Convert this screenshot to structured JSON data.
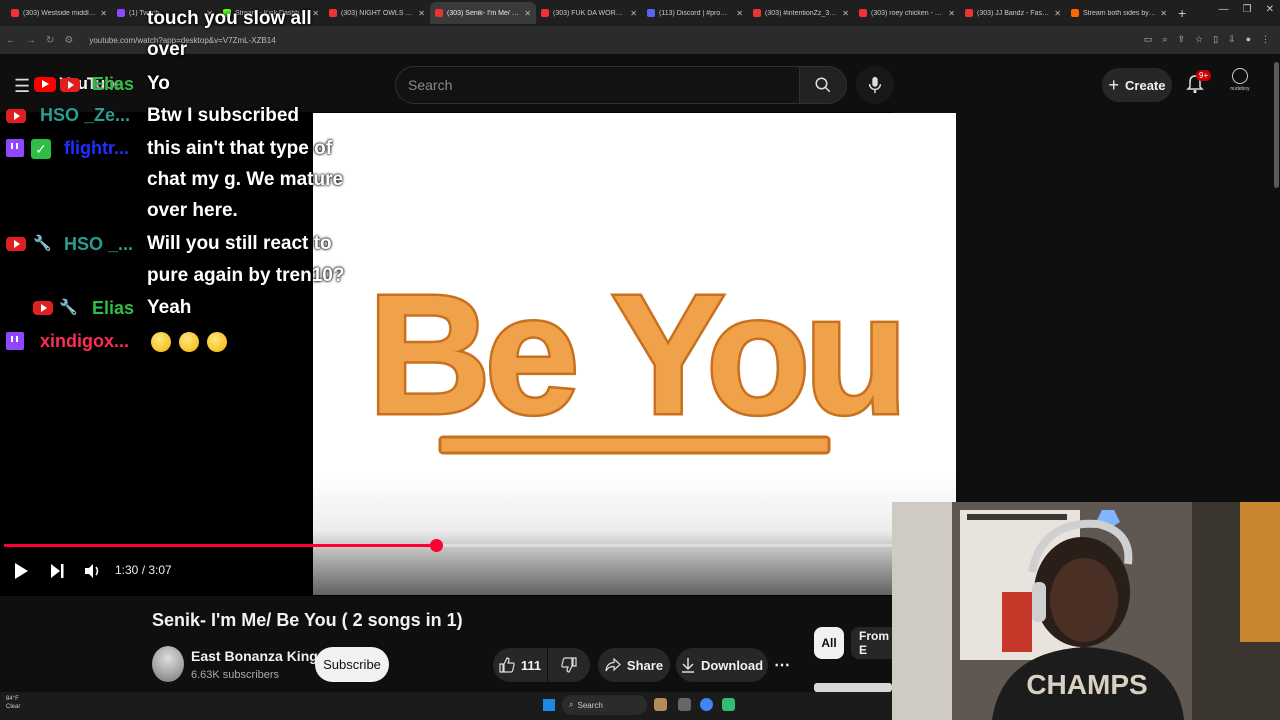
{
  "browser": {
    "tabs": [
      {
        "title": "(303) Westside middle Sch",
        "color": "#e33"
      },
      {
        "title": "(1) Twitch",
        "color": "#9146ff"
      },
      {
        "title": "Stream - Kick Dashboard",
        "color": "#53fc18"
      },
      {
        "title": "(303) NIGHT OWLS UNITE",
        "color": "#e33"
      },
      {
        "title": "(303) Senik- I'm Me/ Be Yo",
        "color": "#e33",
        "active": true
      },
      {
        "title": "(303) FUK DA WORLD - Yo",
        "color": "#e33"
      },
      {
        "title": "(113) Discord | #promote",
        "color": "#5865f2"
      },
      {
        "title": "(303) #intentionZz_33-3",
        "color": "#e33"
      },
      {
        "title": "(303) roey chicken - You",
        "color": "#e33"
      },
      {
        "title": "(303) JJ Bandz - Fast Life",
        "color": "#e33"
      },
      {
        "title": "Stream both sides by sim",
        "color": "#f60"
      }
    ],
    "url": "youtube.com/watch?app=desktop&v=V7ZmL-XZB14"
  },
  "header": {
    "logo_text": "YouTube",
    "search_placeholder": "Search",
    "create_label": "Create",
    "notif_count": "9+",
    "avatar_label": "nudeboy"
  },
  "chat": {
    "lines": [
      {
        "text": "touch you slow all"
      },
      {
        "text": "over"
      },
      {
        "user": "Elias",
        "text": "Yo",
        "user_color": "#2fbe44"
      },
      {
        "user": "HSO _Ze...",
        "text": "Btw I subscribed",
        "user_color": "#2a9d8f"
      },
      {
        "user": "flightr...",
        "text": "this ain't that type of",
        "user_color": "#1f2fff"
      },
      {
        "text": "chat my g. We mature"
      },
      {
        "text": "over here."
      },
      {
        "user": "HSO _...",
        "text": "Will you still react to",
        "user_color": "#2a9d8f"
      },
      {
        "text": "pure again by tren10?"
      },
      {
        "user": "Elias",
        "text": "Yeah",
        "user_color": "#2fbe44"
      },
      {
        "user": "xindigox...",
        "text": "",
        "user_color": "#ff2d55"
      }
    ]
  },
  "video": {
    "art_text": "Be You",
    "time_current": "1:30",
    "time_total": "3:07",
    "time_display": "1:30 / 3:07",
    "progress_fraction": 0.486,
    "title": "Senik- I'm Me/ Be You ( 2 songs in 1)"
  },
  "channel": {
    "name": "East Bonanza Kingz",
    "subscribers": "6.63K subscribers",
    "subscribe_label": "Subscribe"
  },
  "actions": {
    "likes": "111",
    "share_label": "Share",
    "download_label": "Download"
  },
  "chips": {
    "all": "All",
    "from": "From E"
  },
  "webcam": {
    "shirt_text": "CHAMPS"
  },
  "taskbar": {
    "weather_temp": "84°F",
    "weather_desc": "Clear",
    "search_label": "Search"
  }
}
